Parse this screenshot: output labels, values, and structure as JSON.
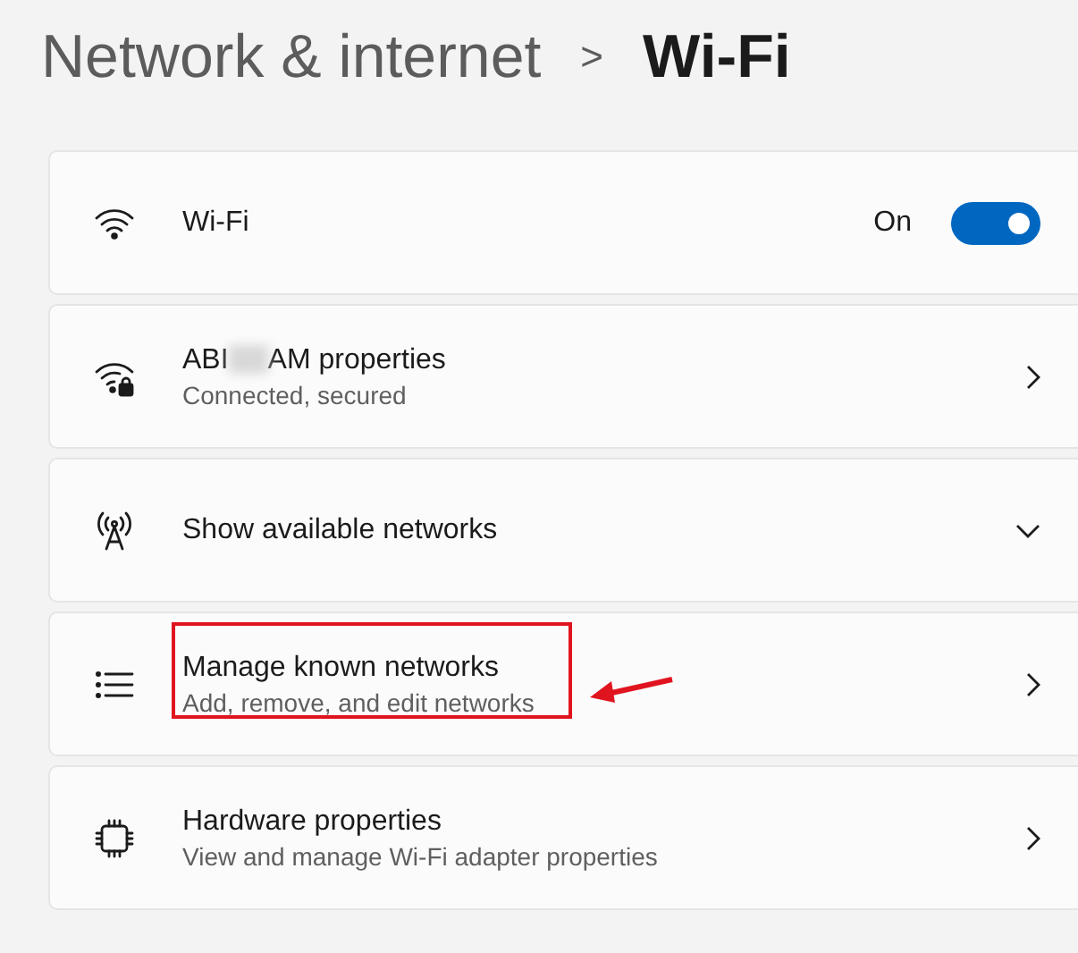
{
  "breadcrumb": {
    "parent": "Network & internet",
    "separator": ">",
    "current": "Wi-Fi"
  },
  "cards": [
    {
      "kind": "toggle",
      "title": "Wi-Fi",
      "state_label": "On",
      "on": true
    },
    {
      "kind": "link",
      "title_start": "ABI",
      "title_end": "AM properties",
      "blurred": true,
      "subtitle": "Connected, secured"
    },
    {
      "kind": "expander",
      "title": "Show available networks",
      "expanded": false
    },
    {
      "kind": "link",
      "title": "Manage known networks",
      "subtitle": "Add, remove, and edit networks",
      "highlighted": true
    },
    {
      "kind": "link",
      "title": "Hardware properties",
      "subtitle": "View and manage Wi-Fi adapter properties"
    }
  ]
}
